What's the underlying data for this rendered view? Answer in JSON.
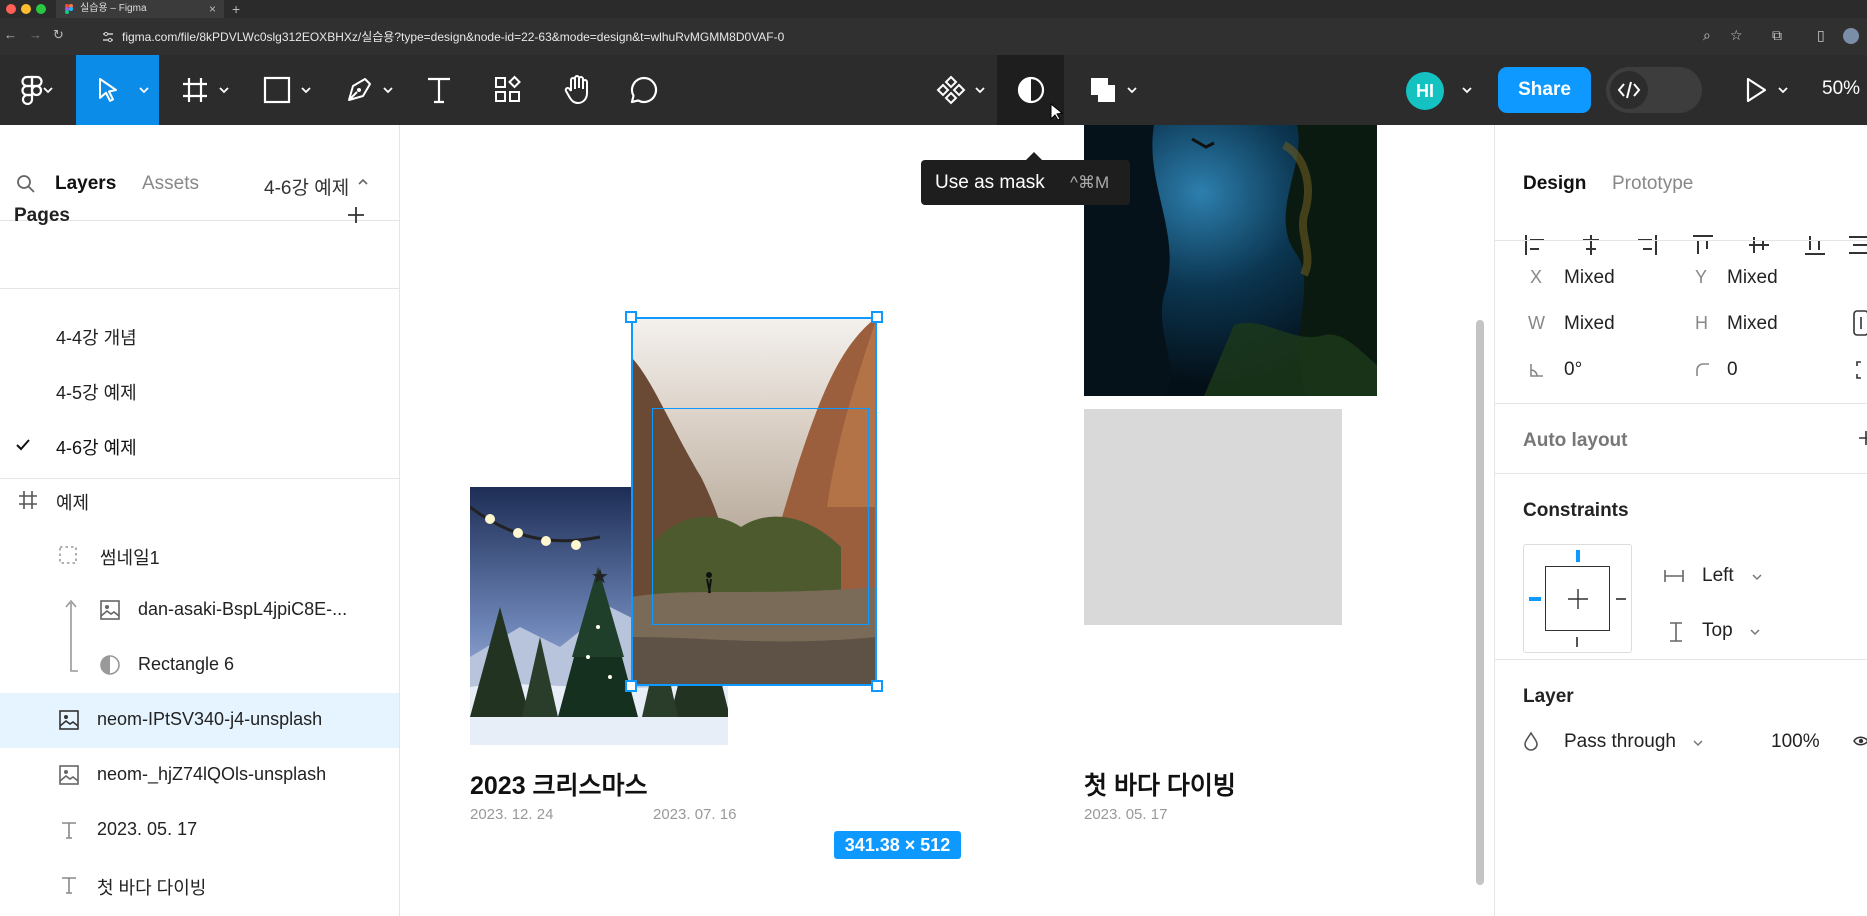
{
  "browser": {
    "tab_title": "실습용 – Figma",
    "tab_close": "×",
    "new_tab": "+",
    "url": "figma.com/file/8kPDVLWc0slg312EOXBHXz/실습용?type=design&node-id=22-63&mode=design&t=wlhuRvMGMM8D0VAF-0"
  },
  "toolbar": {
    "avatar_initials": "HI",
    "share_label": "Share",
    "zoom": "50%"
  },
  "tooltip": {
    "label": "Use as mask",
    "shortcut": "^⌘M"
  },
  "left_panel": {
    "tabs": {
      "layers": "Layers",
      "assets": "Assets"
    },
    "current_page": "4-6강 예제",
    "pages_header": "Pages",
    "pages": [
      "4-4강 개념",
      "4-5강 예제",
      "4-6강 예제"
    ],
    "layers": [
      {
        "label": "예제",
        "icon": "frame-icon"
      },
      {
        "label": "썸네일1",
        "icon": "group-icon"
      },
      {
        "label": "dan-asaki-BspL4jpiC8E-...",
        "icon": "image-icon"
      },
      {
        "label": "Rectangle 6",
        "icon": "mask-icon"
      },
      {
        "label": "neom-IPtSV340-j4-unsplash",
        "icon": "image-icon"
      },
      {
        "label": "neom-_hjZ74lQOls-unsplash",
        "icon": "image-icon"
      },
      {
        "label": "2023. 05. 17",
        "icon": "text-icon"
      },
      {
        "label": "첫 바다 다이빙",
        "icon": "text-icon"
      }
    ]
  },
  "canvas": {
    "cards": [
      {
        "title": "2023 크리스마스",
        "date": "2023. 12. 24"
      },
      {
        "title": "",
        "date": "2023. 07. 16"
      },
      {
        "title": "첫 바다 다이빙",
        "date": "2023. 05. 17"
      }
    ],
    "selection_size": "341.38 × 512"
  },
  "right_panel": {
    "tabs": {
      "design": "Design",
      "prototype": "Prototype"
    },
    "x_label": "X",
    "x_value": "Mixed",
    "y_label": "Y",
    "y_value": "Mixed",
    "w_label": "W",
    "w_value": "Mixed",
    "h_label": "H",
    "h_value": "Mixed",
    "rotation": "0°",
    "radius": "0",
    "auto_layout": "Auto layout",
    "constraints": "Constraints",
    "constraint_h": "Left",
    "constraint_v": "Top",
    "layer": "Layer",
    "blend_mode": "Pass through",
    "opacity": "100%"
  },
  "colors": {
    "accent": "#0d99ff",
    "toolbar_bg": "#2c2c2c",
    "selected_row": "#e5f4ff",
    "placeholder_gray": "#d9d9d9"
  }
}
